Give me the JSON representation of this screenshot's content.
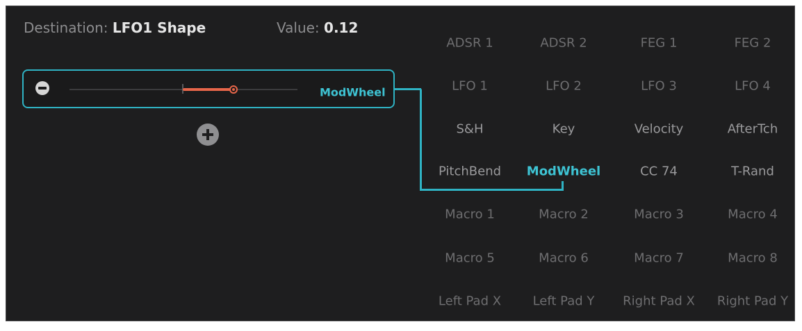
{
  "header": {
    "destination_label": "Destination:",
    "destination_value": "LFO1 Shape",
    "value_label": "Value:",
    "value_value": "0.12"
  },
  "slot": {
    "source": "ModWheel",
    "amount": 0.12,
    "colors": {
      "accent": "#2fb3c4",
      "amount": "#e8664a"
    }
  },
  "sources": {
    "rows": [
      [
        "ADSR 1",
        "ADSR 2",
        "FEG 1",
        "FEG 2"
      ],
      [
        "LFO 1",
        "LFO 2",
        "LFO 3",
        "LFO 4"
      ],
      [
        "S&H",
        "Key",
        "Velocity",
        "AfterTch"
      ],
      [
        "PitchBend",
        "ModWheel",
        "CC 74",
        "T-Rand"
      ],
      [
        "Macro 1",
        "Macro 2",
        "Macro 3",
        "Macro 4"
      ],
      [
        "Macro 5",
        "Macro 6",
        "Macro 7",
        "Macro 8"
      ],
      [
        "Left Pad X",
        "Left Pad Y",
        "Right Pad X",
        "Right Pad Y"
      ]
    ],
    "selected": "ModWheel"
  },
  "icons": {
    "remove": "minus-circle-icon",
    "add": "plus-circle-icon"
  }
}
